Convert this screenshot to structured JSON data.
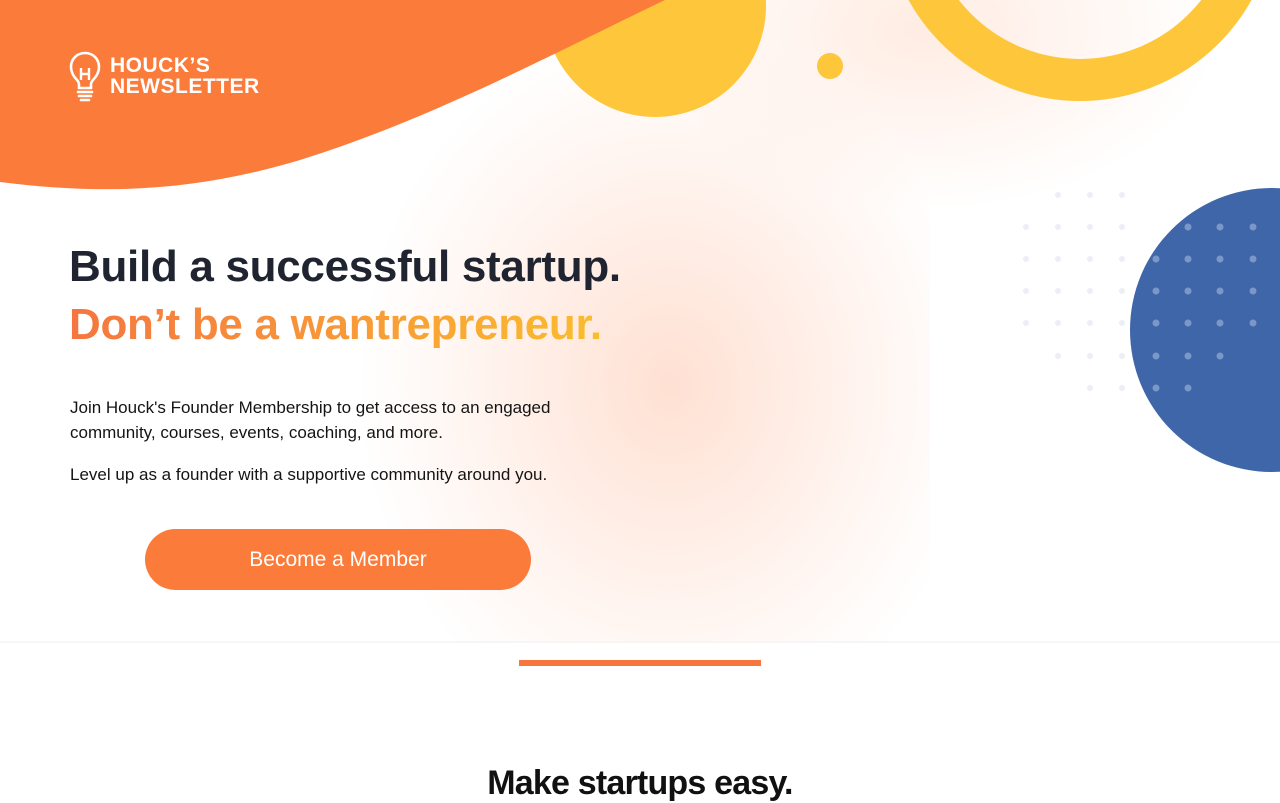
{
  "brand": {
    "logo_line_1": "HOUCK’S",
    "logo_line_2": "NEWSLETTER",
    "logo_icon": "lightbulb-icon"
  },
  "hero": {
    "headline": "Build a successful startup.",
    "subheadline": "Don’t be a wantrepreneur.",
    "paragraph_1": "Join Houck's Founder Membership to get access to an engaged community, courses, events, coaching, and more.",
    "paragraph_2": "Level up as a founder with a supportive community around you.",
    "cta_label": "Become a Member"
  },
  "next_section": {
    "title": "Make startups easy."
  },
  "colors": {
    "orange": "#fb7b3b",
    "yellow": "#fdc63b",
    "blue": "#4066aa",
    "headline_dark": "#1f2430",
    "gradient_start": "#f5763f",
    "gradient_end": "#fbbd2d"
  }
}
